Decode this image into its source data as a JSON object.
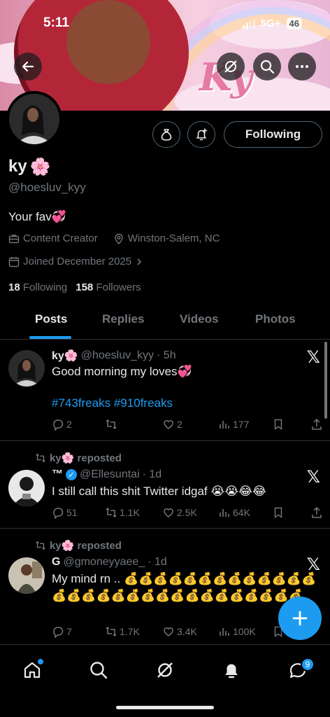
{
  "status_bar": {
    "time": "5:11",
    "network": "5G+",
    "battery": "46"
  },
  "profile": {
    "name": "ky",
    "name_emoji": "🌸",
    "handle": "@hoesluv_kyy",
    "bio": "Your fav💞",
    "category": "Content Creator",
    "location": "Winston-Salem, NC",
    "joined": "Joined December 2025",
    "following_count": "18",
    "following_label": "Following",
    "followers_count": "158",
    "followers_label": "Followers",
    "follow_button": "Following",
    "banner_text": "Ky"
  },
  "tabs": [
    "Posts",
    "Replies",
    "Videos",
    "Photos"
  ],
  "posts": [
    {
      "name": "ky🌸",
      "handle": "@hoesluv_kyy",
      "time": "· 5h",
      "text": "Good morning my loves💞",
      "hashtags": "#743freaks #910freaks",
      "replies": "2",
      "reposts": "",
      "likes": "2",
      "views": "177"
    },
    {
      "repost_label": "ky🌸 reposted",
      "name": "™",
      "handle": "@Ellesuntai",
      "time": "· 1d",
      "text": "I still call this shit Twitter idgaf 😭😭😂😂",
      "replies": "51",
      "reposts": "1.1K",
      "likes": "2.5K",
      "views": "64K"
    },
    {
      "repost_label": "ky🌸 reposted",
      "name": "G",
      "handle": "@gmoneyyaee_",
      "time": "· 1d",
      "text": "My mind rn .. 💰💰💰💰💰💰💰💰💰💰💰💰💰💰💰💰💰💰💰💰💰💰💰💰💰💰💰💰💰💰",
      "replies": "7",
      "reposts": "1.7K",
      "likes": "3.4K",
      "views": "100K"
    }
  ],
  "nav": {
    "messages_badge": "9"
  },
  "colors": {
    "accent": "#1d9bf0",
    "muted": "#71767b",
    "text": "#e7e9ea",
    "background": "#000000"
  }
}
